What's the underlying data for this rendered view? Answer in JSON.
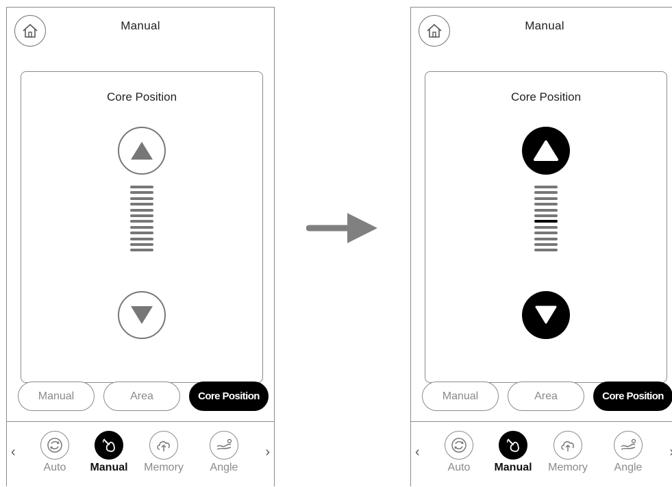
{
  "screens": [
    {
      "title": "Manual",
      "card_title": "Core Position",
      "buttons_style": "outline",
      "bars": 12,
      "active_bar": -1,
      "tabs": [
        "Manual",
        "Area",
        "Core Position"
      ],
      "nav": [
        "Auto",
        "Manual",
        "Memory",
        "Angle"
      ],
      "selected_nav": 1
    },
    {
      "title": "Manual",
      "card_title": "Core Position",
      "buttons_style": "filled",
      "bars": 12,
      "active_bar": 6,
      "tabs": [
        "Manual",
        "Area",
        "Core Position"
      ],
      "nav": [
        "Auto",
        "Manual",
        "Memory",
        "Angle"
      ],
      "selected_nav": 1
    }
  ],
  "chevron_left": "‹",
  "chevron_right": "›",
  "icons": {
    "home": "home-icon",
    "up": "triangle-up-icon",
    "down": "triangle-down-icon",
    "auto": "sync-icon",
    "manual": "hand-pointer-icon",
    "memory": "cloud-upload-icon",
    "angle": "recline-icon"
  },
  "colors": {
    "accent": "#000000",
    "muted": "#8a8a8a",
    "arrow": "#808080"
  }
}
